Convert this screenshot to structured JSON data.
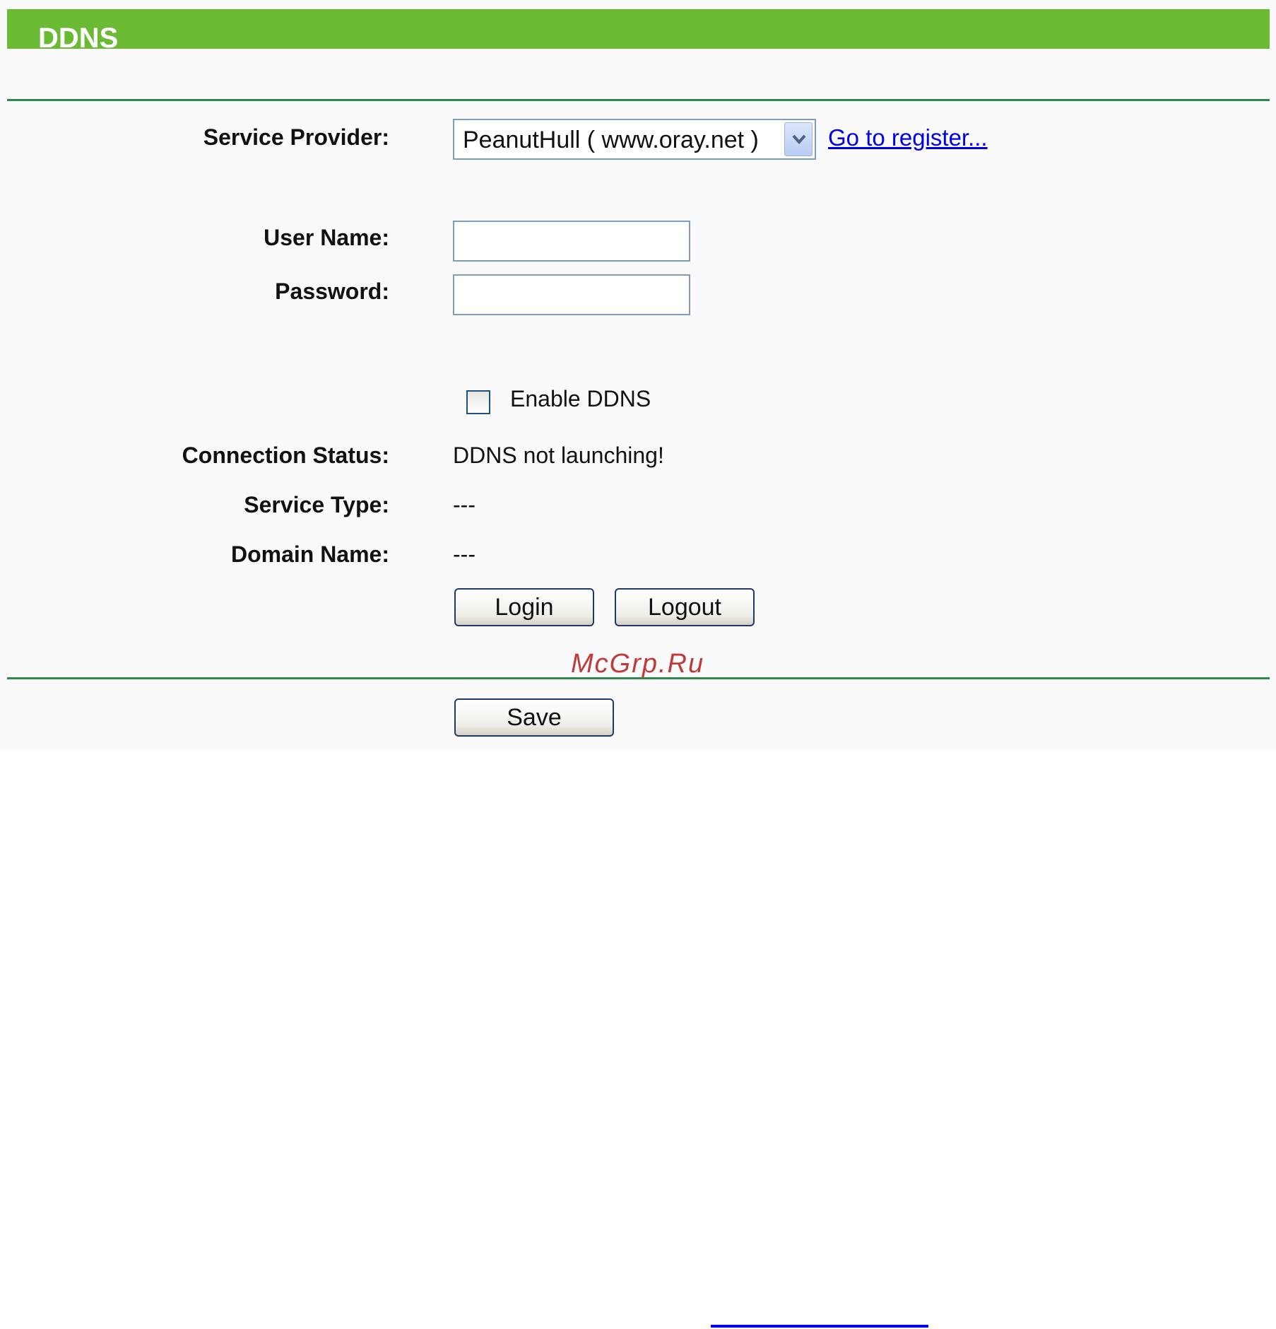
{
  "header": {
    "title": "DDNS"
  },
  "form": {
    "service_provider": {
      "label": "Service Provider:",
      "selected": "PeanutHull ( www.oray.net )",
      "register_link": "Go to register..."
    },
    "user_name": {
      "label": "User Name:",
      "value": ""
    },
    "password": {
      "label": "Password:",
      "value": ""
    },
    "enable_ddns": {
      "label": "Enable DDNS",
      "checked": false
    },
    "connection_status": {
      "label": "Connection Status:",
      "value": "DDNS not launching!"
    },
    "service_type": {
      "label": "Service Type:",
      "value": "---"
    },
    "domain_name": {
      "label": "Domain Name:",
      "value": "---"
    },
    "buttons": {
      "login": "Login",
      "logout": "Logout"
    }
  },
  "footer": {
    "save": "Save"
  },
  "watermark": "McGrp.Ru",
  "colors": {
    "header_green": "#6aba34",
    "rule_green": "#2b8a4a",
    "link_blue": "#0000ee",
    "watermark_red": "#c0393b"
  }
}
